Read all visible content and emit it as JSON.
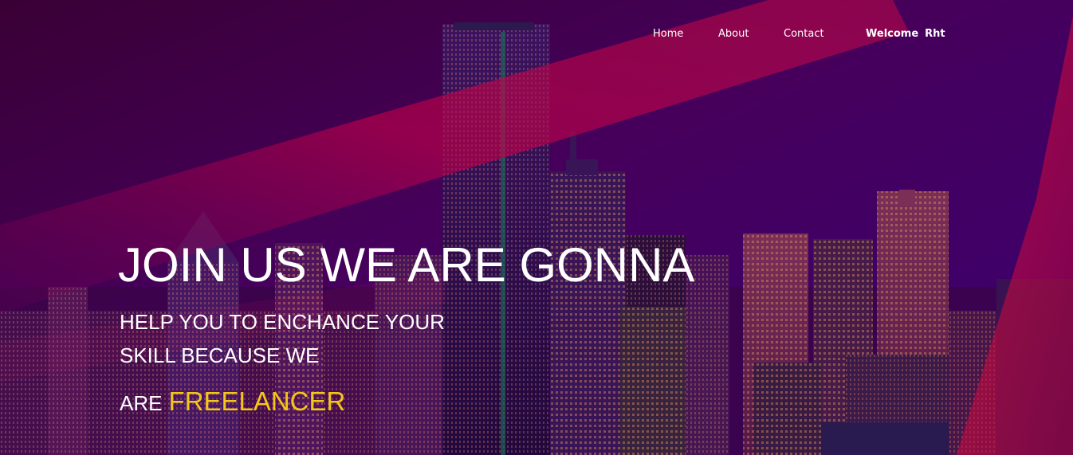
{
  "nav": {
    "links": [
      "Home",
      "About",
      "Contact"
    ],
    "welcome_label": "Welcome",
    "user_name": "Rht"
  },
  "hero": {
    "headline": "JOIN US WE ARE GONNA",
    "line1": "HELP YOU TO ENCHANCE YOUR",
    "line2": "SKILL BECAUSE WE",
    "line3_prefix": "ARE",
    "line3_accent": "FREELANCER"
  },
  "colors": {
    "accent": "#f5c518",
    "text": "#ffffff",
    "background": "#3a0050",
    "light_streak": "#e8003a"
  }
}
